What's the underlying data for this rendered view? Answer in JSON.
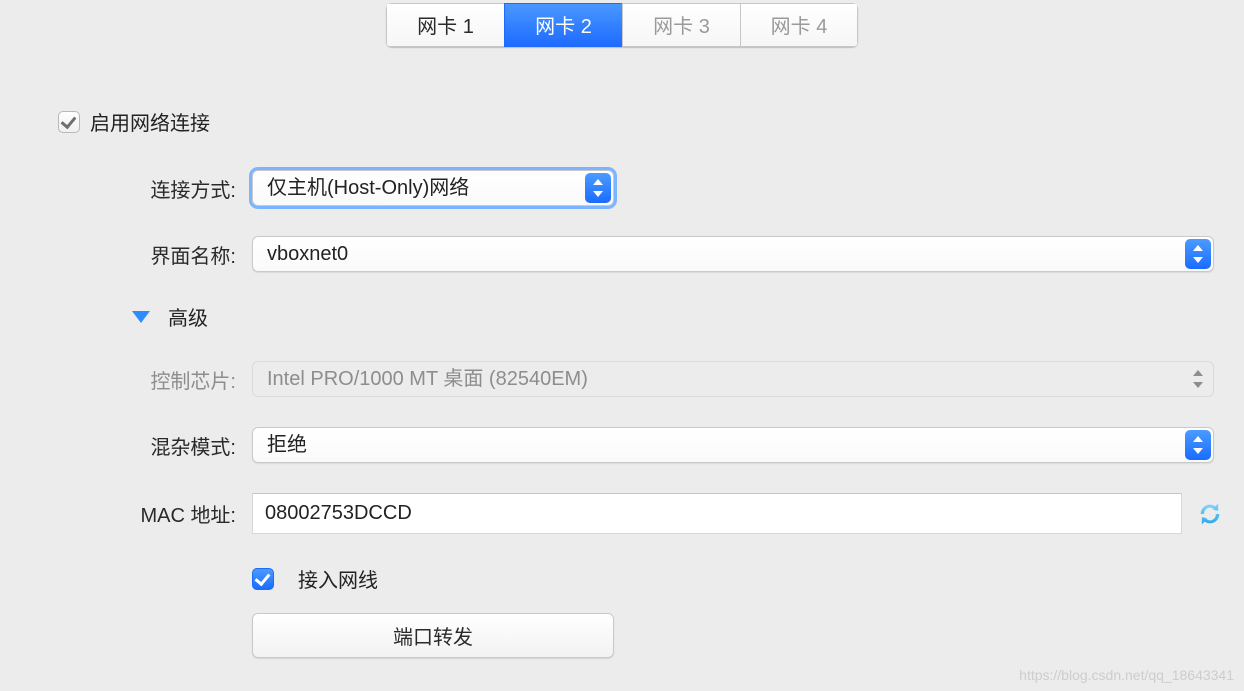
{
  "tabs": {
    "items": [
      {
        "label": "网卡 1",
        "key": "adapter-1"
      },
      {
        "label": "网卡 2",
        "key": "adapter-2"
      },
      {
        "label": "网卡 3",
        "key": "adapter-3"
      },
      {
        "label": "网卡 4",
        "key": "adapter-4"
      }
    ],
    "active_index": 1,
    "disabled_indices": [
      2,
      3
    ]
  },
  "enable_network": {
    "label": "启用网络连接",
    "checked": true
  },
  "fields": {
    "attached_to": {
      "label": "连接方式:",
      "value": "仅主机(Host-Only)网络"
    },
    "interface": {
      "label": "界面名称:",
      "value": "vboxnet0"
    },
    "advanced": {
      "label": "高级"
    },
    "adapter_type": {
      "label": "控制芯片:",
      "value": "Intel PRO/1000 MT 桌面 (82540EM)",
      "enabled": false
    },
    "promiscuous": {
      "label": "混杂模式:",
      "value": "拒绝"
    },
    "mac_address": {
      "label": "MAC 地址:",
      "value": "08002753DCCD"
    },
    "cable": {
      "label": "接入网线",
      "checked": true
    },
    "port_forward": {
      "label": "端口转发"
    }
  },
  "watermark": "https://blog.csdn.net/qq_18643341"
}
